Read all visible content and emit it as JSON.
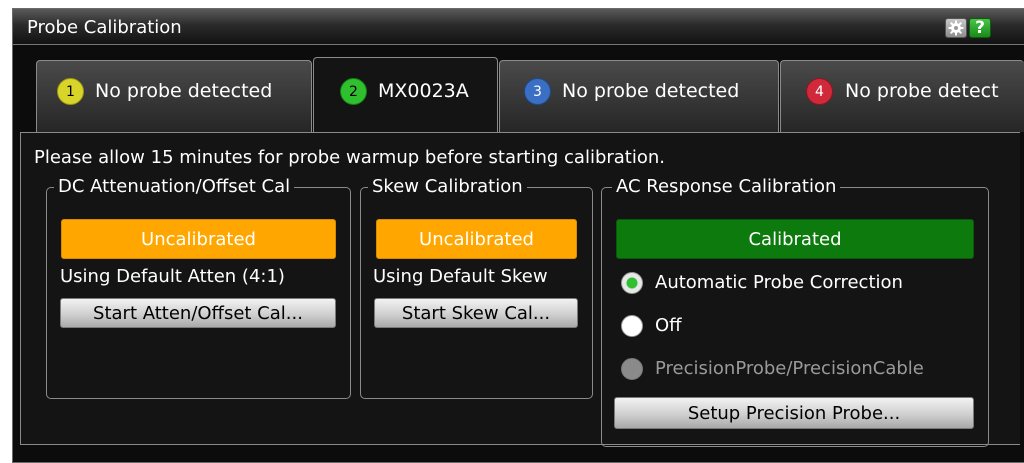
{
  "window": {
    "title": "Probe Calibration",
    "gear_icon": "gear-icon",
    "help_label": "?"
  },
  "tabs": [
    {
      "number": "1",
      "label": "No probe detected",
      "color": "#d8d42a",
      "active": false
    },
    {
      "number": "2",
      "label": "MX0023A",
      "color": "#2fbf2f",
      "active": true
    },
    {
      "number": "3",
      "label": "No probe detected",
      "color": "#3a6fc4",
      "active": false
    },
    {
      "number": "4",
      "label": "No probe detect",
      "color": "#d02a3a",
      "active": false
    }
  ],
  "notice": "Please allow 15 minutes for probe warmup before starting calibration.",
  "dc_cal": {
    "title": "DC Attenuation/Offset Cal",
    "status": "Uncalibrated",
    "info": "Using Default Atten (4:1)",
    "button": "Start Atten/Offset Cal..."
  },
  "skew_cal": {
    "title": "Skew Calibration",
    "status": "Uncalibrated",
    "info": "Using Default Skew",
    "button": "Start Skew Cal..."
  },
  "ac_cal": {
    "title": "AC Response Calibration",
    "status": "Calibrated",
    "options": [
      {
        "label": "Automatic Probe Correction",
        "selected": true,
        "enabled": true
      },
      {
        "label": "Off",
        "selected": false,
        "enabled": true
      },
      {
        "label": "PrecisionProbe/PrecisionCable",
        "selected": false,
        "enabled": false
      }
    ],
    "button": "Setup Precision Probe..."
  },
  "colors": {
    "uncalibrated": "#ffa600",
    "calibrated": "#0d7a0d"
  }
}
